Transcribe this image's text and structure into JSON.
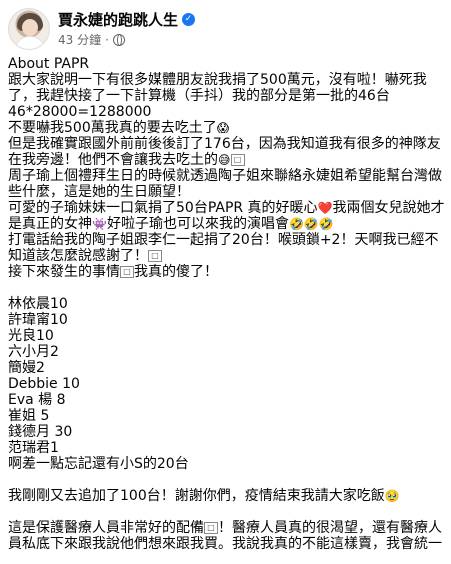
{
  "header": {
    "page_name": "賈永婕的跑跳人生",
    "verified_icon": "verified-badge-icon",
    "time": "43 分鐘",
    "separator": "·",
    "privacy_icon": "globe-icon"
  },
  "post": {
    "lines": [
      "About PAPR",
      "跟大家說明一下有很多媒體朋友說我捐了500萬元，沒有啦！嚇死我了，我趕快接了一下計算機（手抖）我的部分是第一批的46台",
      "46*28000=1288000",
      "不要嚇我500萬我真的要去吃土了",
      "但是我確實跟國外前前後後訂了176台，因為我知道我有很多的神隊友在我旁邊！他們不會讓我去吃土的",
      "周子瑜上個禮拜生日的時候就透過陶子姐來聯絡永婕姐希望能幫台灣做些什麼，這是她的生日願望！",
      "可愛的子瑜妹妹一口氣捐了50台PAPR 真的好暖心",
      "我兩個女兒說她才是真正的女神",
      "好啦子瑜也可以來我的演唱會",
      "打電話給我的陶子姐跟李仁一起捐了20台！喉頭鎖+2！天啊我已經不知道該怎麼說感謝了！",
      "接下來發生的事情",
      "我真的傻了！",
      "林依晨10",
      "許瑋甯10",
      "光良10",
      "六小月2",
      "簡嫚2",
      "Debbie 10",
      "Eva 楊 8",
      "崔姐 5",
      "錢德月 30",
      "范瑞君1",
      "啊差一點忘記還有小S的20台",
      "我剛剛又去追加了100台！謝謝你們，疫情結束我請大家吃飯",
      "這是保護醫療人員非常好的配備",
      "！醫療人員真的很渴望，還有醫療人員私底下來跟我說他們想來跟我買。我說我真的不能這樣賣，我會統一"
    ],
    "emoji": {
      "scream": "😱",
      "grin_sweat": "😅",
      "heart": "❤️",
      "alien": "👾",
      "rofl": "🤣",
      "smile": "🥹",
      "box": "🥺"
    }
  }
}
